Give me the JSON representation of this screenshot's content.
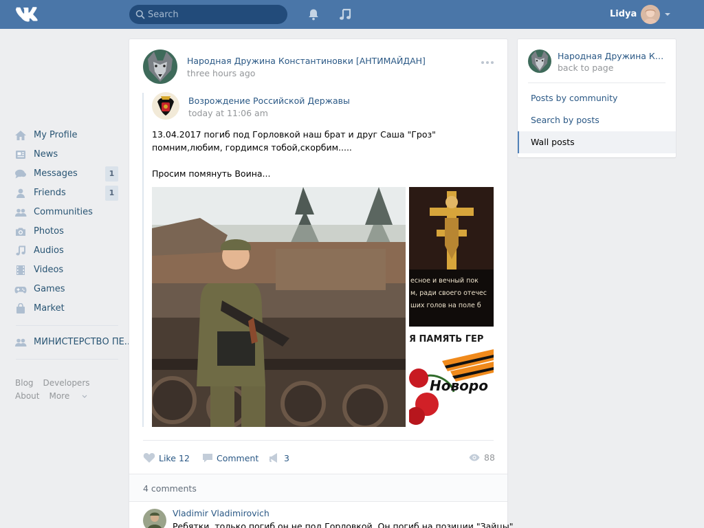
{
  "header": {
    "search_placeholder": "Search",
    "user_name": "Lidya"
  },
  "nav": {
    "items": [
      {
        "label": "My Profile",
        "icon": "home-icon"
      },
      {
        "label": "News",
        "icon": "news-icon"
      },
      {
        "label": "Messages",
        "icon": "messages-icon",
        "count": "1"
      },
      {
        "label": "Friends",
        "icon": "friends-icon",
        "count": "1"
      },
      {
        "label": "Communities",
        "icon": "communities-icon"
      },
      {
        "label": "Photos",
        "icon": "camera-icon"
      },
      {
        "label": "Audios",
        "icon": "music-note-icon"
      },
      {
        "label": "Videos",
        "icon": "film-icon"
      },
      {
        "label": "Games",
        "icon": "gamepad-icon"
      },
      {
        "label": "Market",
        "icon": "shopping-bag-icon"
      }
    ],
    "group_item": {
      "label": "МИНИСТЕРСТВО ПЕ...",
      "icon": "communities-icon"
    },
    "footer": {
      "blog": "Blog",
      "developers": "Developers",
      "about": "About",
      "more": "More"
    }
  },
  "post": {
    "author": "Народная Дружина Константиновки [АНТИМАЙДАН]",
    "time": "three hours ago",
    "repost": {
      "author": "Возрождение Российской Державы",
      "time": "today at 11:06 am",
      "text": "13.04.2017 погиб под Горловкой наш брат и друг Саша \"Гроз\" помним,любим, гордимся тобой,скорбим.....\n\nПросим помянуть Воина..."
    },
    "side_image_texts": {
      "icon_line1": "есное и вечный пок",
      "icon_line2": "м, ради своего отечес",
      "icon_line3": "ших голов на поле б",
      "banner_line1": "Я ПАМЯТЬ ГЕР",
      "banner_line2": "Новоро"
    },
    "actions": {
      "like_label": "Like",
      "like_count": "12",
      "comment_label": "Comment",
      "share_count": "3",
      "views": "88"
    },
    "comments_count_label": "4 comments",
    "comment": {
      "author": "Vladimir Vladimirovich",
      "text": "Ребятки, только погиб он не под Горловкой. Он погиб на позиции \"Зайцы\"."
    }
  },
  "sidebar": {
    "community_name": "Народная Дружина Конст...",
    "back_label": "back to page",
    "links": [
      {
        "label": "Posts by community",
        "active": false
      },
      {
        "label": "Search by posts",
        "active": false
      },
      {
        "label": "Wall posts",
        "active": true
      }
    ]
  },
  "colors": {
    "header": "#4a76a8",
    "link": "#2a5885",
    "background": "#edeef0"
  }
}
